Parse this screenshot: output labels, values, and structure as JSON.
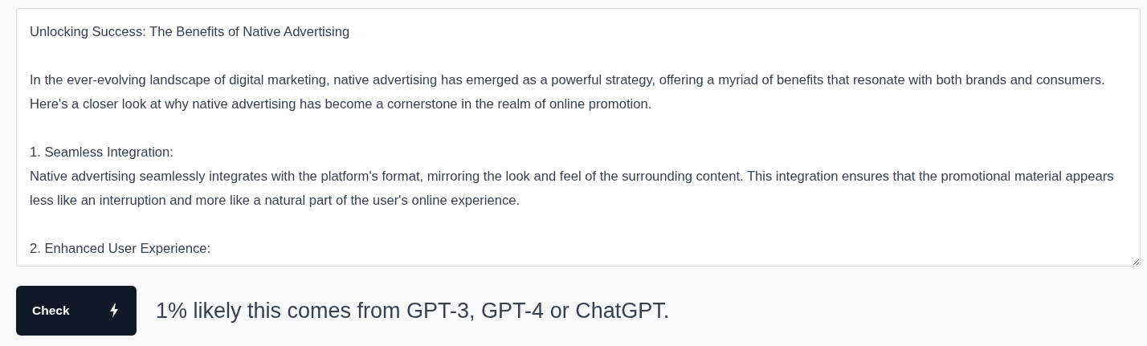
{
  "text_field": {
    "value": "Unlocking Success: The Benefits of Native Advertising\n\nIn the ever-evolving landscape of digital marketing, native advertising has emerged as a powerful strategy, offering a myriad of benefits that resonate with both brands and consumers. Here's a closer look at why native advertising has become a cornerstone in the realm of online promotion.\n\n1. Seamless Integration:\nNative advertising seamlessly integrates with the platform's format, mirroring the look and feel of the surrounding content. This integration ensures that the promotional material appears less like an interruption and more like a natural part of the user's online experience.\n\n2. Enhanced User Experience:"
  },
  "check_button": {
    "label": "Check"
  },
  "result": "1% likely this comes from GPT-3, GPT-4 or ChatGPT."
}
